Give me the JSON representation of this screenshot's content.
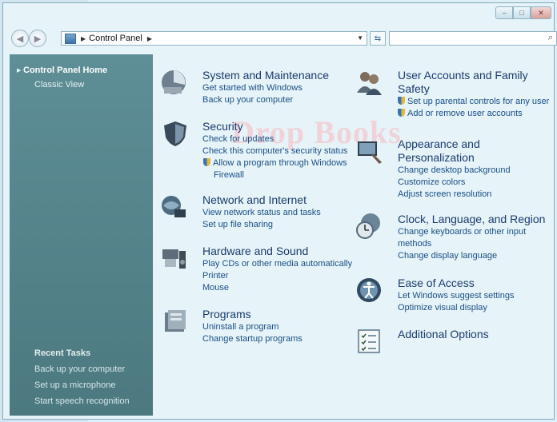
{
  "window": {
    "controls": {
      "minimize": "–",
      "maximize": "□",
      "close": "✕"
    }
  },
  "nav": {
    "back_icon": "back-arrow-icon",
    "forward_icon": "forward-arrow-icon",
    "breadcrumb": "Control Panel",
    "refresh_glyph": "⇆",
    "search_placeholder": ""
  },
  "sidebar": {
    "home": "Control Panel Home",
    "classic": "Classic View",
    "recent_title": "Recent Tasks",
    "recent": [
      "Back up your computer",
      "Set up a microphone",
      "Start speech recognition"
    ]
  },
  "watermark": "Drop Books",
  "categories_left": [
    {
      "title": "System and Maintenance",
      "icon": "system-maintenance-icon",
      "links": [
        "Get started with Windows",
        "Back up your computer"
      ]
    },
    {
      "title": "Security",
      "icon": "security-shield-icon",
      "links": [
        "Check for updates",
        "Check this computer's security status",
        "Allow a program through Windows",
        "Firewall"
      ]
    },
    {
      "title": "Network and Internet",
      "icon": "network-globe-icon",
      "links": [
        "View network status and tasks",
        "Set up file sharing"
      ]
    },
    {
      "title": "Hardware and Sound",
      "icon": "hardware-sound-icon",
      "links": [
        "Play CDs or other media automatically",
        "Printer",
        "Mouse"
      ]
    },
    {
      "title": "Programs",
      "icon": "programs-icon",
      "links": [
        "Uninstall a program",
        "Change startup programs"
      ]
    }
  ],
  "categories_right": [
    {
      "title_lines": [
        "User Accounts and Family",
        "Safety"
      ],
      "icon": "user-accounts-icon",
      "links": [
        "Set up parental controls for any user",
        "Add or remove user accounts"
      ]
    },
    {
      "title_lines": [
        "Appearance and",
        "Personalization"
      ],
      "icon": "appearance-icon",
      "links": [
        "Change desktop background",
        "Customize colors",
        "Adjust screen resolution"
      ]
    },
    {
      "title_lines": [
        "Clock, Language, and Region"
      ],
      "icon": "clock-globe-icon",
      "links": [
        "Change keyboards or other input",
        "methods",
        "Change display language"
      ]
    },
    {
      "title_lines": [
        "Ease of Access"
      ],
      "icon": "ease-of-access-icon",
      "links": [
        "Let Windows suggest settings",
        "Optimize visual display"
      ]
    },
    {
      "title_lines": [
        "Additional Options"
      ],
      "icon": "additional-options-icon",
      "links": []
    }
  ]
}
